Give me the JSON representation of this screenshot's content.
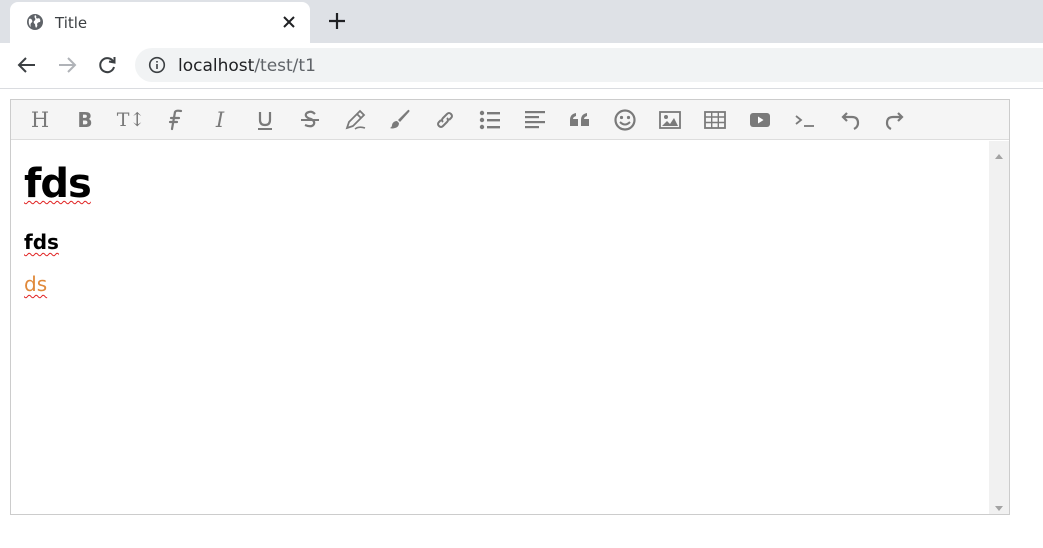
{
  "browser": {
    "tab": {
      "title": "Title",
      "icon": "globe-icon"
    },
    "url": {
      "host": "localhost",
      "path": "/test/t1"
    }
  },
  "editor": {
    "toolbar": [
      {
        "name": "heading-button",
        "glyph": "H",
        "icon": "heading-icon"
      },
      {
        "name": "bold-button",
        "glyph": "B",
        "icon": "bold-icon"
      },
      {
        "name": "font-size-button",
        "glyph": "T↕",
        "icon": "text-height-icon"
      },
      {
        "name": "font-family-button",
        "glyph": "",
        "icon": "font-icon"
      },
      {
        "name": "italic-button",
        "glyph": "I",
        "icon": "italic-icon"
      },
      {
        "name": "underline-button",
        "glyph": "U",
        "icon": "underline-icon"
      },
      {
        "name": "strikethrough-button",
        "glyph": "S",
        "icon": "strikethrough-icon"
      },
      {
        "name": "text-color-button",
        "glyph": "",
        "icon": "pencil-icon"
      },
      {
        "name": "background-color-button",
        "glyph": "",
        "icon": "brush-icon"
      },
      {
        "name": "link-button",
        "glyph": "",
        "icon": "link-icon"
      },
      {
        "name": "list-button",
        "glyph": "",
        "icon": "list-icon"
      },
      {
        "name": "align-button",
        "glyph": "",
        "icon": "align-left-icon"
      },
      {
        "name": "quote-button",
        "glyph": "",
        "icon": "quote-icon"
      },
      {
        "name": "emoticon-button",
        "glyph": "",
        "icon": "smile-icon"
      },
      {
        "name": "image-button",
        "glyph": "",
        "icon": "image-icon"
      },
      {
        "name": "table-button",
        "glyph": "",
        "icon": "table-icon"
      },
      {
        "name": "video-button",
        "glyph": "",
        "icon": "video-icon"
      },
      {
        "name": "code-button",
        "glyph": "",
        "icon": "terminal-icon"
      },
      {
        "name": "undo-button",
        "glyph": "",
        "icon": "undo-icon"
      },
      {
        "name": "redo-button",
        "glyph": "",
        "icon": "redo-icon"
      }
    ],
    "content": {
      "heading1": "fds",
      "heading2": "fds",
      "paragraph": "ds",
      "paragraph_color": "#e0893a"
    }
  }
}
